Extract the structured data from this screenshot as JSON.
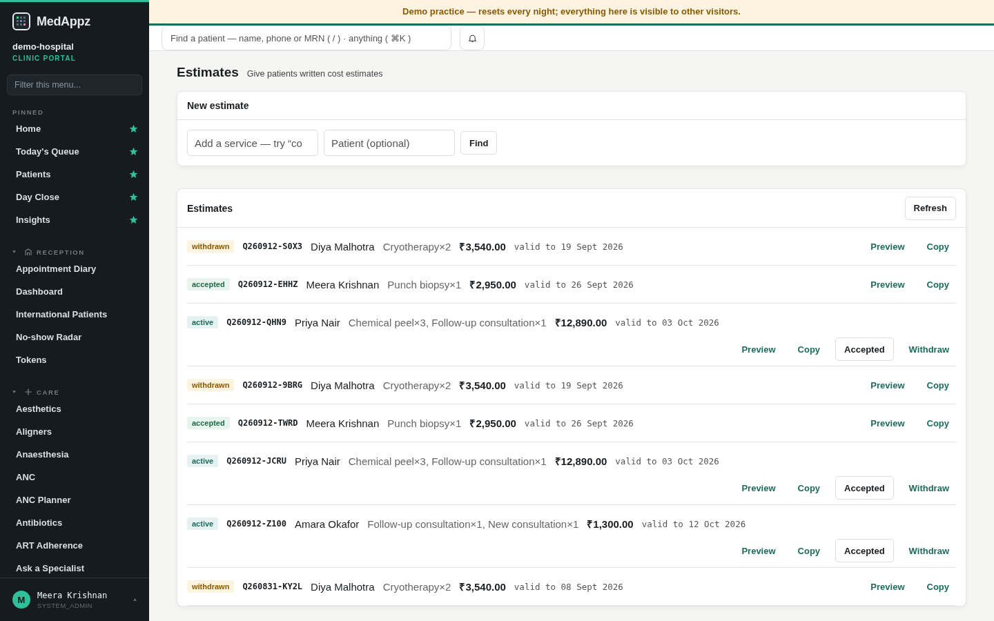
{
  "banner": {
    "text": "Demo practice — resets every night; everything here is visible to other visitors."
  },
  "sidebar": {
    "brand": "MedAppz",
    "org": "demo-hospital",
    "portal": "CLINIC PORTAL",
    "filter_placeholder": "Filter this menu...",
    "sections": [
      {
        "title": "PINNED",
        "kind": "pinned",
        "items": [
          {
            "label": "Home",
            "pinned": true
          },
          {
            "label": "Today's Queue",
            "pinned": true
          },
          {
            "label": "Patients",
            "pinned": true
          },
          {
            "label": "Day Close",
            "pinned": true
          },
          {
            "label": "Insights",
            "pinned": true
          }
        ]
      },
      {
        "title": "RECEPTION",
        "kind": "reception",
        "items": [
          {
            "label": "Appointment Diary"
          },
          {
            "label": "Dashboard"
          },
          {
            "label": "International Patients"
          },
          {
            "label": "No-show Radar"
          },
          {
            "label": "Tokens"
          }
        ]
      },
      {
        "title": "CARE",
        "kind": "care",
        "items": [
          {
            "label": "Aesthetics"
          },
          {
            "label": "Aligners"
          },
          {
            "label": "Anaesthesia"
          },
          {
            "label": "ANC"
          },
          {
            "label": "ANC Planner"
          },
          {
            "label": "Antibiotics"
          },
          {
            "label": "ART Adherence"
          },
          {
            "label": "Ask a Specialist"
          }
        ]
      }
    ],
    "user": {
      "initial": "M",
      "name": "Meera Krishnan",
      "role": "SYSTEM_ADMIN"
    }
  },
  "topbar": {
    "search_placeholder": "Find a patient — name, phone or MRN ( / ) · anything ( ⌘K )"
  },
  "page": {
    "title": "Estimates",
    "subtitle": "Give patients written cost estimates"
  },
  "new_estimate": {
    "title": "New estimate",
    "service_placeholder": "Add a service — try “co",
    "patient_placeholder": "Patient (optional)",
    "button": "Find"
  },
  "estimates": {
    "title": "Estimates",
    "refresh": "Refresh",
    "rows": [
      {
        "status": "withdrawn",
        "id": "Q260912-S0X3",
        "patient": "Diya Malhotra",
        "services": "Cryotherapy×2",
        "amount": "₹3,540.00",
        "valid": "valid to 19 Sept 2026",
        "actions": [
          {
            "label": "Preview",
            "kind": "link"
          },
          {
            "label": "Copy",
            "kind": "link"
          }
        ]
      },
      {
        "status": "accepted",
        "id": "Q260912-EHHZ",
        "patient": "Meera Krishnan",
        "services": "Punch biopsy×1",
        "amount": "₹2,950.00",
        "valid": "valid to 26 Sept 2026",
        "actions": [
          {
            "label": "Preview",
            "kind": "link"
          },
          {
            "label": "Copy",
            "kind": "link"
          }
        ]
      },
      {
        "status": "active",
        "id": "Q260912-QHN9",
        "patient": "Priya Nair",
        "services": "Chemical peel×3, Follow-up consultation×1",
        "amount": "₹12,890.00",
        "valid": "valid to 03 Oct 2026",
        "actions": [
          {
            "label": "Preview",
            "kind": "link"
          },
          {
            "label": "Copy",
            "kind": "link"
          },
          {
            "label": "Accepted",
            "kind": "outline"
          },
          {
            "label": "Withdraw",
            "kind": "link"
          }
        ]
      },
      {
        "status": "withdrawn",
        "id": "Q260912-9BRG",
        "patient": "Diya Malhotra",
        "services": "Cryotherapy×2",
        "amount": "₹3,540.00",
        "valid": "valid to 19 Sept 2026",
        "actions": [
          {
            "label": "Preview",
            "kind": "link"
          },
          {
            "label": "Copy",
            "kind": "link"
          }
        ]
      },
      {
        "status": "accepted",
        "id": "Q260912-TWRD",
        "patient": "Meera Krishnan",
        "services": "Punch biopsy×1",
        "amount": "₹2,950.00",
        "valid": "valid to 26 Sept 2026",
        "actions": [
          {
            "label": "Preview",
            "kind": "link"
          },
          {
            "label": "Copy",
            "kind": "link"
          }
        ]
      },
      {
        "status": "active",
        "id": "Q260912-JCRU",
        "patient": "Priya Nair",
        "services": "Chemical peel×3, Follow-up consultation×1",
        "amount": "₹12,890.00",
        "valid": "valid to 03 Oct 2026",
        "actions": [
          {
            "label": "Preview",
            "kind": "link"
          },
          {
            "label": "Copy",
            "kind": "link"
          },
          {
            "label": "Accepted",
            "kind": "outline"
          },
          {
            "label": "Withdraw",
            "kind": "link"
          }
        ]
      },
      {
        "status": "active",
        "id": "Q260912-Z100",
        "patient": "Amara Okafor",
        "services": "Follow-up consultation×1, New consultation×1",
        "amount": "₹1,300.00",
        "valid": "valid to 12 Oct 2026",
        "actions": [
          {
            "label": "Preview",
            "kind": "link"
          },
          {
            "label": "Copy",
            "kind": "link"
          },
          {
            "label": "Accepted",
            "kind": "outline"
          },
          {
            "label": "Withdraw",
            "kind": "link"
          }
        ]
      },
      {
        "status": "withdrawn",
        "id": "Q260831-KY2L",
        "patient": "Diya Malhotra",
        "services": "Cryotherapy×2",
        "amount": "₹3,540.00",
        "valid": "valid to 08 Sept 2026",
        "actions": [
          {
            "label": "Preview",
            "kind": "link"
          },
          {
            "label": "Copy",
            "kind": "link"
          }
        ]
      }
    ]
  }
}
